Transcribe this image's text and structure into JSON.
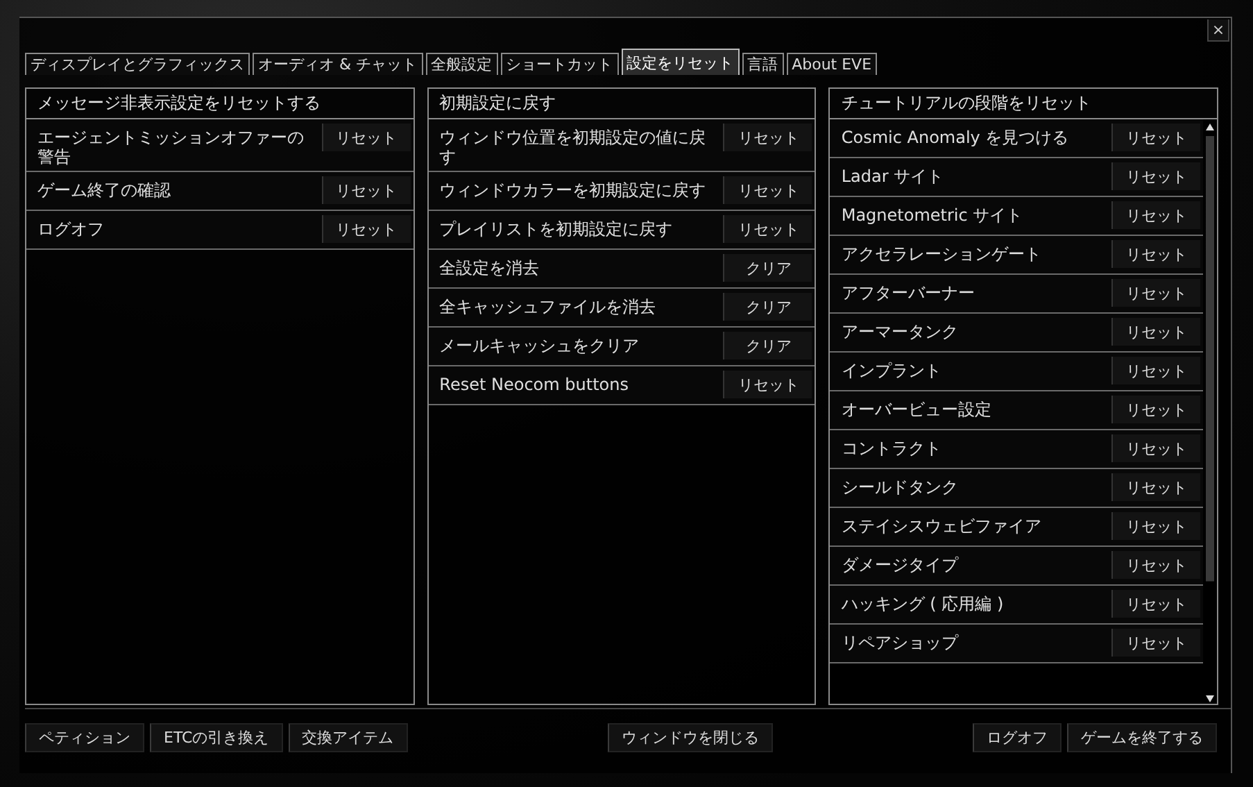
{
  "window": {
    "close": "×"
  },
  "tabs": [
    {
      "label": "ディスプレイとグラフィックス",
      "selected": false
    },
    {
      "label": "オーディオ & チャット",
      "selected": false
    },
    {
      "label": "全般設定",
      "selected": false
    },
    {
      "label": "ショートカット",
      "selected": false
    },
    {
      "label": "設定をリセット",
      "selected": true
    },
    {
      "label": "言語",
      "selected": false
    },
    {
      "label": "About EVE",
      "selected": false
    }
  ],
  "panels": [
    {
      "title": "メッセージ非表示設定をリセットする",
      "scrollbar": false,
      "rows": [
        {
          "label": "エージェントミッションオファーの警告",
          "button": "リセット"
        },
        {
          "label": "ゲーム終了の確認",
          "button": "リセット"
        },
        {
          "label": "ログオフ",
          "button": "リセット"
        }
      ]
    },
    {
      "title": "初期設定に戻す",
      "scrollbar": false,
      "rows": [
        {
          "label": "ウィンドウ位置を初期設定の値に戻す",
          "button": "リセット"
        },
        {
          "label": "ウィンドウカラーを初期設定に戻す",
          "button": "リセット"
        },
        {
          "label": "プレイリストを初期設定に戻す",
          "button": "リセット"
        },
        {
          "label": "全設定を消去",
          "button": "クリア"
        },
        {
          "label": "全キャッシュファイルを消去",
          "button": "クリア"
        },
        {
          "label": "メールキャッシュをクリア",
          "button": "クリア"
        },
        {
          "label": "Reset Neocom buttons",
          "button": "リセット"
        }
      ]
    },
    {
      "title": "チュートリアルの段階をリセット",
      "scrollbar": true,
      "rows": [
        {
          "label": "Cosmic Anomaly を見つける",
          "button": "リセット"
        },
        {
          "label": "Ladar サイト",
          "button": "リセット"
        },
        {
          "label": "Magnetometric サイト",
          "button": "リセット"
        },
        {
          "label": "アクセラレーションゲート",
          "button": "リセット"
        },
        {
          "label": "アフターバーナー",
          "button": "リセット"
        },
        {
          "label": "アーマータンク",
          "button": "リセット"
        },
        {
          "label": "インプラント",
          "button": "リセット"
        },
        {
          "label": "オーバービュー設定",
          "button": "リセット"
        },
        {
          "label": "コントラクト",
          "button": "リセット"
        },
        {
          "label": "シールドタンク",
          "button": "リセット"
        },
        {
          "label": "ステイシスウェビファイア",
          "button": "リセット"
        },
        {
          "label": "ダメージタイプ",
          "button": "リセット"
        },
        {
          "label": "ハッキング ( 応用編 )",
          "button": "リセット"
        },
        {
          "label": "リペアショップ",
          "button": "リセット"
        }
      ]
    }
  ],
  "footer": {
    "left": [
      "ペティション",
      "ETCの引き換え",
      "交換アイテム"
    ],
    "center": [
      "ウィンドウを閉じる"
    ],
    "right": [
      "ログオフ",
      "ゲームを終了する"
    ]
  }
}
